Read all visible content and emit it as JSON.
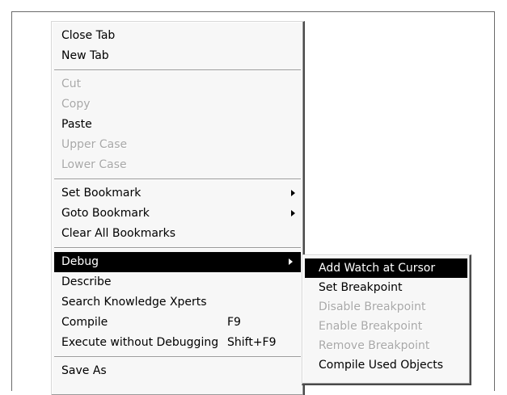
{
  "main_menu": {
    "group1": [
      {
        "label": "Close Tab"
      },
      {
        "label": "New Tab"
      }
    ],
    "group2": [
      {
        "label": "Cut",
        "enabled": false
      },
      {
        "label": "Copy",
        "enabled": false
      },
      {
        "label": "Paste",
        "enabled": true
      },
      {
        "label": "Upper Case",
        "enabled": false
      },
      {
        "label": "Lower Case",
        "enabled": false
      }
    ],
    "group3": [
      {
        "label": "Set Bookmark",
        "has_submenu": true
      },
      {
        "label": "Goto Bookmark",
        "has_submenu": true
      },
      {
        "label": "Clear All Bookmarks"
      }
    ],
    "group4": [
      {
        "label": "Debug",
        "has_submenu": true,
        "highlighted": true
      },
      {
        "label": "Describe"
      },
      {
        "label": "Search Knowledge Xperts"
      },
      {
        "label": "Compile",
        "shortcut": "F9"
      },
      {
        "label": "Execute without Debugging",
        "shortcut": "Shift+F9"
      }
    ],
    "group5": [
      {
        "label": "Save As"
      }
    ]
  },
  "debug_submenu": [
    {
      "label": "Add Watch at Cursor",
      "highlighted": true,
      "enabled": true
    },
    {
      "label": "Set Breakpoint",
      "enabled": true
    },
    {
      "label": "Disable Breakpoint",
      "enabled": false
    },
    {
      "label": "Enable Breakpoint",
      "enabled": false
    },
    {
      "label": "Remove Breakpoint",
      "enabled": false
    },
    {
      "label": "Compile Used Objects",
      "enabled": true
    }
  ],
  "colors": {
    "highlight_bg": "#000000",
    "highlight_text": "#ffffff",
    "disabled_text": "#a8a8a8",
    "menu_bg": "#f7f7f7"
  }
}
